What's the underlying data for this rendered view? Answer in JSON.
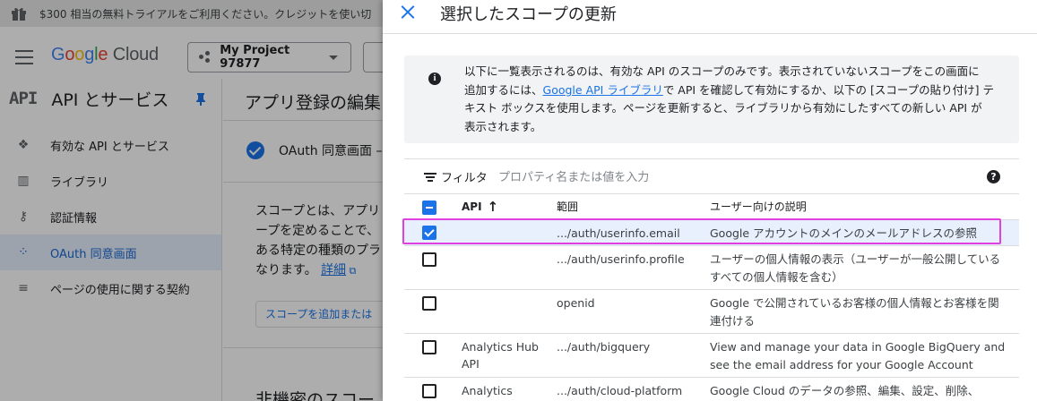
{
  "banner": {
    "text": "$300 相当の無料トライアルをご利用ください。クレジットを使い切"
  },
  "topbar": {
    "logo": {
      "google": "Google",
      "cloud": "Cloud"
    },
    "project": "My Project 97877"
  },
  "sidebar": {
    "api_logo": "API",
    "title": "API とサービス",
    "items": [
      {
        "label": "有効な API とサービス",
        "icon": "api-icon"
      },
      {
        "label": "ライブラリ",
        "icon": "library-icon"
      },
      {
        "label": "認証情報",
        "icon": "key-icon"
      },
      {
        "label": "OAuth 同意画面",
        "icon": "oauth-icon",
        "active": true
      },
      {
        "label": "ページの使用に関する契約",
        "icon": "settings-list-icon"
      }
    ]
  },
  "main": {
    "title": "アプリ登録の編集",
    "step": "OAuth 同意画面 –",
    "body_lines": [
      "スコープとは、アプリ",
      "ープを定めることで、",
      "ある特定の種類のプラ",
      "なります。"
    ],
    "body_link": "詳細",
    "add_scope": "スコープを追加または",
    "nonsensitive": "非機密のスコー"
  },
  "panel": {
    "title": "選択したスコープの更新",
    "info": {
      "line1": "以下に一覧表示されるのは、有効な API のスコープのみです。表示されていないスコープをこの画面に",
      "line2_pre": "追加するには、",
      "line2_link": "Google API ライブラリ",
      "line2_post": "で API を確認して有効にするか、以下の [スコープの貼り付け] テ",
      "line3": "キスト ボックスを使用します。ページを更新すると、ライブラリから有効にしたすべての新しい API が",
      "line4": "表示されます。"
    },
    "filter": {
      "label": "フィルタ",
      "placeholder": "プロパティ名または値を入力"
    },
    "table": {
      "headers": {
        "api": "API",
        "scope": "範囲",
        "desc": "ユーザー向けの説明"
      },
      "rows": [
        {
          "api": "",
          "scope": ".../auth/userinfo.email",
          "desc": "Google アカウントのメインのメールアドレスの参照",
          "checked": true
        },
        {
          "api": "",
          "scope": ".../auth/userinfo.profile",
          "desc": "ユーザーの個人情報の表示（ユーザーが一般公開しているすべての個人情報を含む）",
          "checked": false
        },
        {
          "api": "",
          "scope": "openid",
          "desc": "Google で公開されているお客様の個人情報とお客様を関連付ける",
          "checked": false
        },
        {
          "api": "Analytics Hub API",
          "scope": ".../auth/bigquery",
          "desc": "View and manage your data in Google BigQuery and see the email address for your Google Account",
          "checked": false
        },
        {
          "api": "Analytics",
          "scope": ".../auth/cloud-platform",
          "desc": "Google Cloud のデータの参照、編集、設定、削除、",
          "checked": false
        }
      ]
    }
  }
}
